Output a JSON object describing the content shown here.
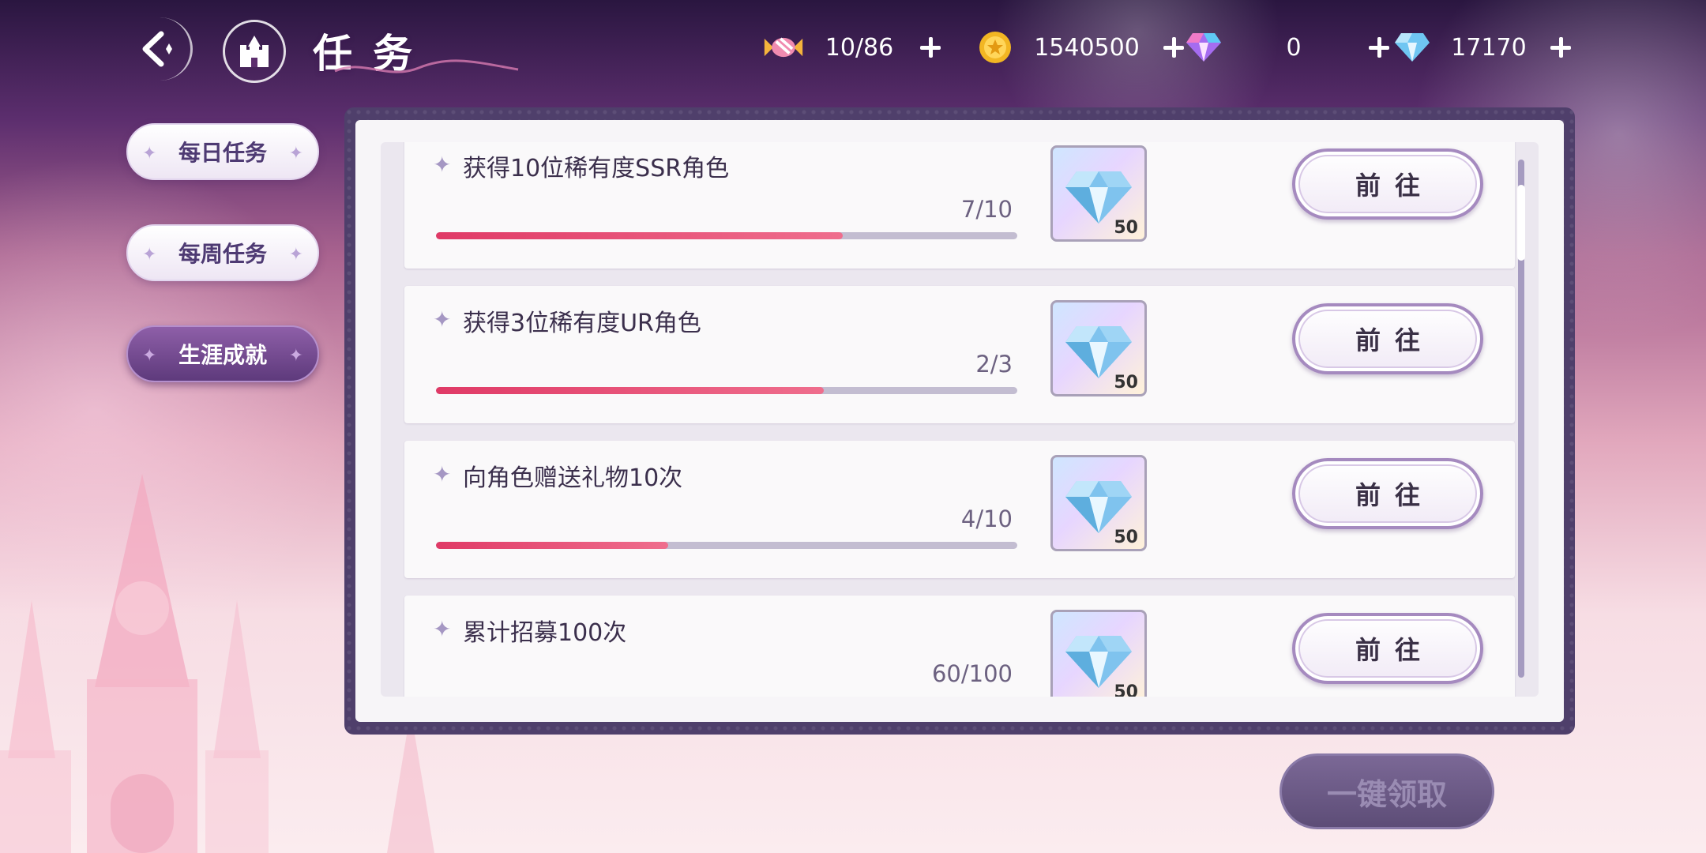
{
  "header": {
    "title": "任务"
  },
  "resources": [
    {
      "icon": "candy-icon",
      "value": "10/86"
    },
    {
      "icon": "gold-coin-icon",
      "value": "1540500"
    },
    {
      "icon": "rainbow-gem-icon",
      "value": "0"
    },
    {
      "icon": "blue-diamond-icon",
      "value": "17170"
    }
  ],
  "sidebar": {
    "tabs": [
      {
        "label": "每日任务",
        "active": false
      },
      {
        "label": "每周任务",
        "active": false
      },
      {
        "label": "生涯成就",
        "active": true
      }
    ]
  },
  "tasks": [
    {
      "title": "获得10位稀有度SSR角色",
      "count": "7/10",
      "progress": 0.7,
      "reward_icon": "diamond-icon",
      "reward_amount": "50",
      "action": "前往"
    },
    {
      "title": "获得3位稀有度UR角色",
      "count": "2/3",
      "progress": 0.667,
      "reward_icon": "diamond-icon",
      "reward_amount": "50",
      "action": "前往"
    },
    {
      "title": "向角色赠送礼物10次",
      "count": "4/10",
      "progress": 0.4,
      "reward_icon": "diamond-icon",
      "reward_amount": "50",
      "action": "前往"
    },
    {
      "title": "累计招募100次",
      "count": "60/100",
      "progress": 0.6,
      "reward_icon": "diamond-icon",
      "reward_amount": "50",
      "action": "前往"
    }
  ],
  "footer": {
    "claim_all_label": "一键领取"
  },
  "colors": {
    "progress_fill": "#e03a66",
    "progress_track": "#c3bdd1",
    "active_tab": "#6e4a8c",
    "frame": "#4f3f6b"
  }
}
